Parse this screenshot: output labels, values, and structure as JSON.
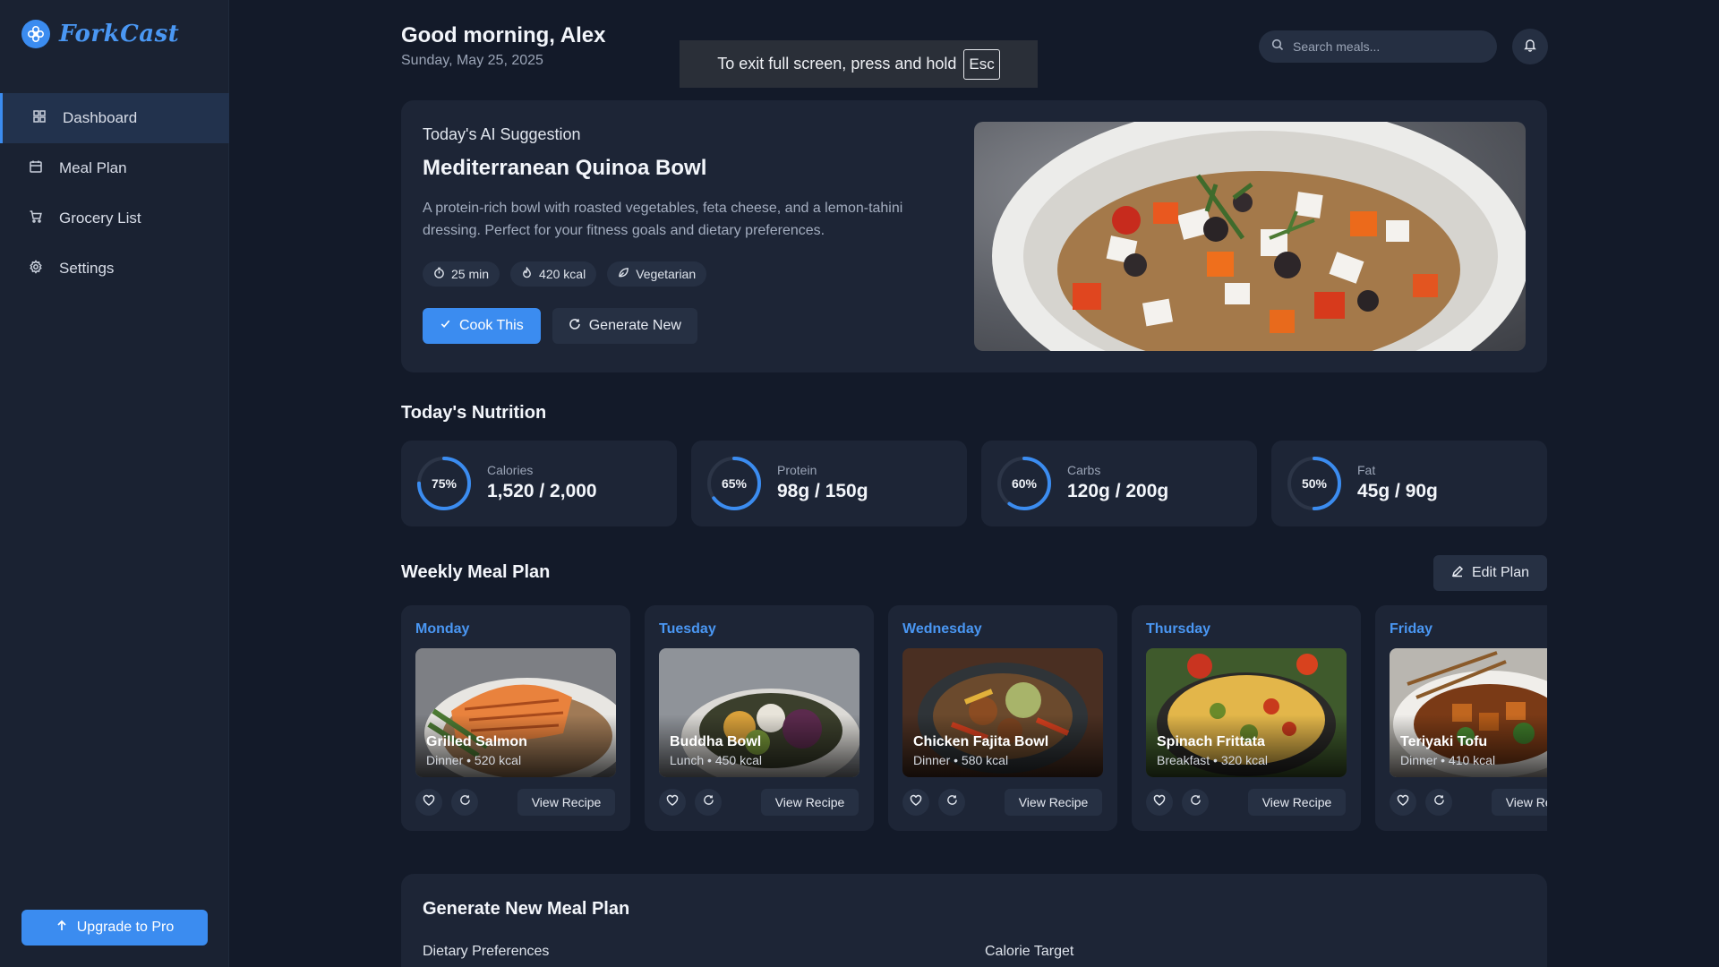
{
  "brand": {
    "name": "ForkCast",
    "accent": "#3b8cf0"
  },
  "sidebar": {
    "items": [
      {
        "label": "Dashboard",
        "icon": "grid-icon",
        "active": true
      },
      {
        "label": "Meal Plan",
        "icon": "calendar-icon",
        "active": false
      },
      {
        "label": "Grocery List",
        "icon": "cart-icon",
        "active": false
      },
      {
        "label": "Settings",
        "icon": "gear-icon",
        "active": false
      }
    ],
    "upgrade_label": "Upgrade to Pro"
  },
  "header": {
    "greeting": "Good morning, Alex",
    "date": "Sunday, May 25, 2025",
    "search_placeholder": "Search meals..."
  },
  "fullscreen_notice": {
    "text": "To exit full screen, press and hold",
    "key": "Esc"
  },
  "suggestion": {
    "label": "Today's AI Suggestion",
    "title": "Mediterranean Quinoa Bowl",
    "description": "A protein-rich bowl with roasted vegetables, feta cheese, and a lemon-tahini dressing. Perfect for your fitness goals and dietary preferences.",
    "chips": [
      {
        "icon": "timer-icon",
        "text": "25 min"
      },
      {
        "icon": "flame-icon",
        "text": "420 kcal"
      },
      {
        "icon": "leaf-icon",
        "text": "Vegetarian"
      }
    ],
    "cook_label": "Cook This",
    "generate_label": "Generate New"
  },
  "nutrition": {
    "title": "Today's Nutrition",
    "cards": [
      {
        "label": "Calories",
        "value": "1,520 / 2,000",
        "percent": 75,
        "percent_text": "75%"
      },
      {
        "label": "Protein",
        "value": "98g / 150g",
        "percent": 65,
        "percent_text": "65%"
      },
      {
        "label": "Carbs",
        "value": "120g / 200g",
        "percent": 60,
        "percent_text": "60%"
      },
      {
        "label": "Fat",
        "value": "45g / 90g",
        "percent": 50,
        "percent_text": "50%"
      }
    ]
  },
  "weekly": {
    "title": "Weekly Meal Plan",
    "edit_label": "Edit Plan",
    "view_label": "View Recipe",
    "days": [
      {
        "day": "Monday",
        "meal": "Grilled Salmon",
        "meta": "Dinner • 520 kcal"
      },
      {
        "day": "Tuesday",
        "meal": "Buddha Bowl",
        "meta": "Lunch • 450 kcal"
      },
      {
        "day": "Wednesday",
        "meal": "Chicken Fajita Bowl",
        "meta": "Dinner • 580 kcal"
      },
      {
        "day": "Thursday",
        "meal": "Spinach Frittata",
        "meta": "Breakfast • 320 kcal"
      },
      {
        "day": "Friday",
        "meal": "Teriyaki Tofu",
        "meta": "Dinner • 410 kcal"
      }
    ]
  },
  "generate": {
    "title": "Generate New Meal Plan",
    "dietary_label": "Dietary Preferences",
    "calorie_label": "Calorie Target"
  }
}
